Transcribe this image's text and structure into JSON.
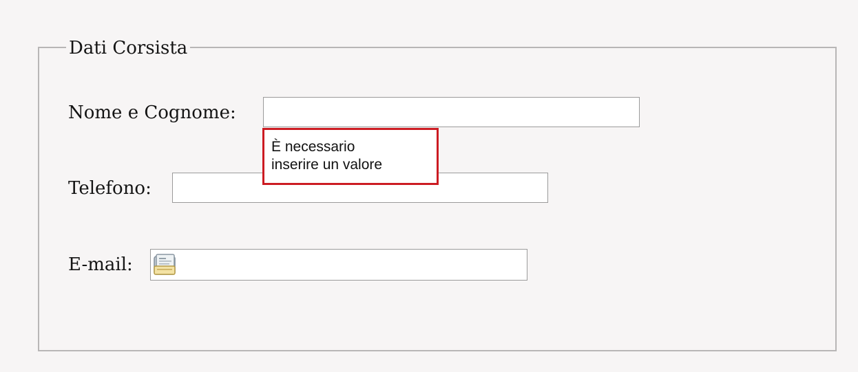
{
  "fieldset": {
    "legend": "Dati Corsista"
  },
  "fields": {
    "nome": {
      "label": "Nome e Cognome:",
      "value": ""
    },
    "telefono": {
      "label": "Telefono:",
      "value": ""
    },
    "email": {
      "label": "E-mail:",
      "value": "",
      "icon": "contact-card-icon"
    }
  },
  "tooltip": {
    "line1": "È necessario",
    "line2": "inserire un valore",
    "border_color": "#cc1b22"
  }
}
